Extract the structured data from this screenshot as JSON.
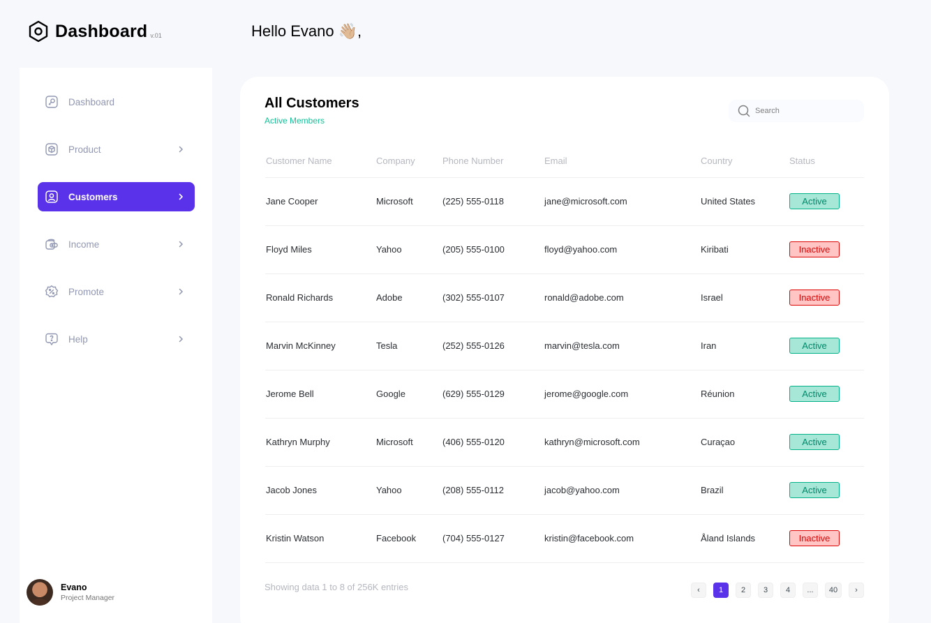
{
  "brand": {
    "title": "Dashboard",
    "version": "v.01"
  },
  "greeting": {
    "text": "Hello Evano",
    "emoji": "👋🏼",
    "suffix": ","
  },
  "sidebar": {
    "items": [
      {
        "label": "Dashboard",
        "icon": "key-icon",
        "chevron": false,
        "active": false
      },
      {
        "label": "Product",
        "icon": "cube-icon",
        "chevron": true,
        "active": false
      },
      {
        "label": "Customers",
        "icon": "user-square-icon",
        "chevron": true,
        "active": true
      },
      {
        "label": "Income",
        "icon": "wallet-money-icon",
        "chevron": true,
        "active": false
      },
      {
        "label": "Promote",
        "icon": "discount-shape-icon",
        "chevron": true,
        "active": false
      },
      {
        "label": "Help",
        "icon": "message-question-icon",
        "chevron": true,
        "active": false
      }
    ],
    "profile": {
      "name": "Evano",
      "role": "Project Manager"
    }
  },
  "main": {
    "title": "All Customers",
    "subtitle": "Active Members",
    "search": {
      "placeholder": "Search"
    },
    "table": {
      "columns": [
        "Customer Name",
        "Company",
        "Phone Number",
        "Email",
        "Country",
        "Status"
      ],
      "rows": [
        {
          "name": "Jane Cooper",
          "company": "Microsoft",
          "phone": "(225) 555-0118",
          "email": "jane@microsoft.com",
          "country": "United States",
          "status": "Active"
        },
        {
          "name": "Floyd Miles",
          "company": "Yahoo",
          "phone": "(205) 555-0100",
          "email": "floyd@yahoo.com",
          "country": "Kiribati",
          "status": "Inactive"
        },
        {
          "name": "Ronald Richards",
          "company": "Adobe",
          "phone": "(302) 555-0107",
          "email": "ronald@adobe.com",
          "country": "Israel",
          "status": "Inactive"
        },
        {
          "name": "Marvin McKinney",
          "company": "Tesla",
          "phone": "(252) 555-0126",
          "email": "marvin@tesla.com",
          "country": "Iran",
          "status": "Active"
        },
        {
          "name": "Jerome Bell",
          "company": "Google",
          "phone": "(629) 555-0129",
          "email": "jerome@google.com",
          "country": "Réunion",
          "status": "Active"
        },
        {
          "name": "Kathryn Murphy",
          "company": "Microsoft",
          "phone": "(406) 555-0120",
          "email": "kathryn@microsoft.com",
          "country": "Curaçao",
          "status": "Active"
        },
        {
          "name": "Jacob Jones",
          "company": "Yahoo",
          "phone": "(208) 555-0112",
          "email": "jacob@yahoo.com",
          "country": "Brazil",
          "status": "Active"
        },
        {
          "name": "Kristin Watson",
          "company": "Facebook",
          "phone": "(704) 555-0127",
          "email": "kristin@facebook.com",
          "country": "Åland Islands",
          "status": "Inactive"
        }
      ]
    },
    "footer": {
      "info": "Showing data 1 to 8 of 256K entries"
    },
    "pagination": {
      "prev": "‹",
      "next": "›",
      "pages": [
        "1",
        "2",
        "3",
        "4",
        "...",
        "40"
      ],
      "current": "1"
    }
  },
  "colors": {
    "accent": "#5932ea",
    "active_bg": "#a6e7d8",
    "active_text": "#008767",
    "inactive_bg": "#ffc5c5",
    "inactive_text": "#df0404",
    "subtitle": "#16c098"
  }
}
